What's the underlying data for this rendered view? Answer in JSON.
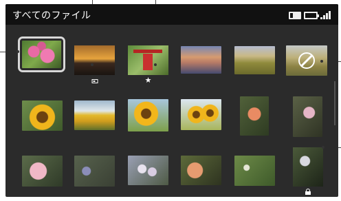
{
  "title_bar": {
    "title": "すべてのファイル"
  },
  "status_icons": [
    "memory-card-icon",
    "battery-icon",
    "signal-icon"
  ],
  "thumbnails": [
    {
      "name": "flower-pink",
      "selected": true
    },
    {
      "name": "sunset-movie",
      "badge": "movie"
    },
    {
      "name": "red-gate",
      "badge": "favorite"
    },
    {
      "name": "sunset-clouds"
    },
    {
      "name": "golden-field"
    },
    {
      "name": "field-disabled",
      "badge": "unsupported"
    },
    {
      "name": "sunflower-1"
    },
    {
      "name": "sunflower-field"
    },
    {
      "name": "sunflower-2"
    },
    {
      "name": "sunflower-3"
    },
    {
      "name": "rose-orange"
    },
    {
      "name": "pink-rose-bush"
    },
    {
      "name": "pink-rose"
    },
    {
      "name": "blue-flower"
    },
    {
      "name": "white-flowers"
    },
    {
      "name": "orange-rose"
    },
    {
      "name": "leaves-flowers"
    },
    {
      "name": "protected-flower",
      "badge": "protected"
    }
  ],
  "colors": {
    "screen": "#2b2b2b",
    "titlebar": "#111111",
    "selection": "#d8d8d8"
  }
}
